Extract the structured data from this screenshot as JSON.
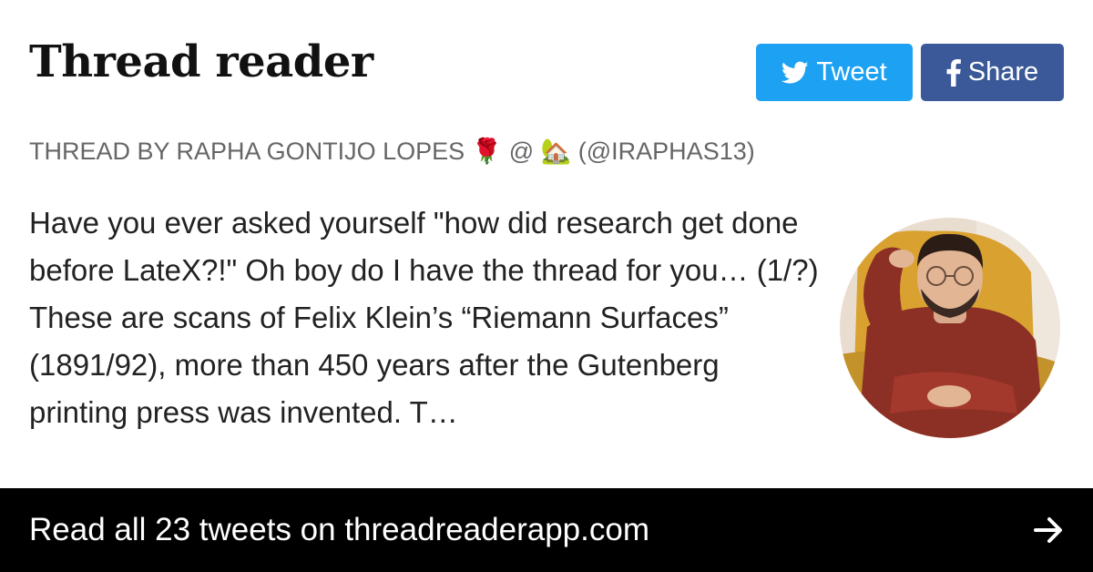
{
  "header": {
    "brand": "Thread reader",
    "tweet_label": "Tweet",
    "share_label": "Share"
  },
  "thread": {
    "byline": "Thread by Rapha Gontijo Lopes 🌹 @ 🏡 (@iraphas13)",
    "text": "Have you ever asked yourself \"how did research get done before LateX?!\" Oh boy do I have the thread for you… (1/?) These are scans of Felix Klein’s “Riemann Surfaces” (1891/92), more than 450 years after the Gutenberg printing press was invented. T…"
  },
  "footer": {
    "cta": "Read all 23 tweets on threadreaderapp.com"
  },
  "colors": {
    "tweet_bg": "#1da1f2",
    "share_bg": "#3b5998",
    "footer_bg": "#000000",
    "byline": "#666666"
  },
  "icons": {
    "tweet": "twitter-bird-icon",
    "share": "facebook-f-icon",
    "footer": "arrow-right-icon"
  }
}
